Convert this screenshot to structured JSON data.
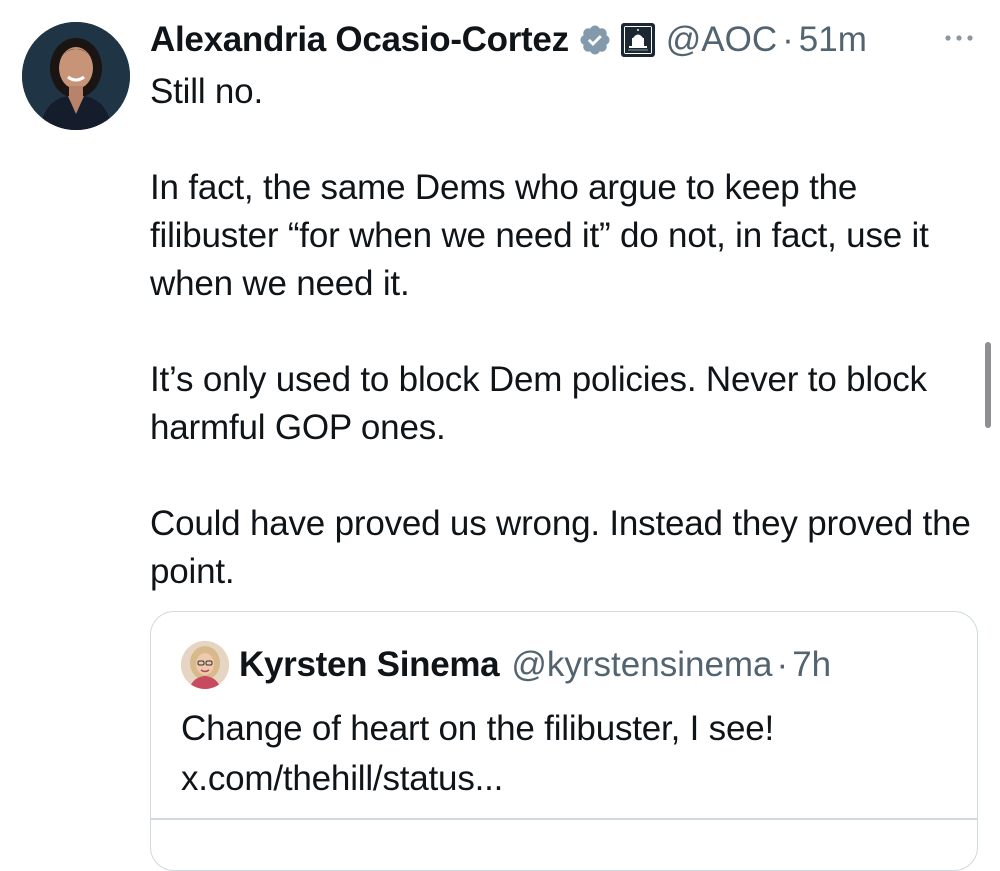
{
  "tweet": {
    "author_name": "Alexandria Ocasio-Cortez",
    "handle": "@AOC",
    "separator": "·",
    "time": "51m",
    "paragraphs": [
      "Still no.",
      "In fact, the same Dems who argue to keep the filibuster “for when we need it” do not, in fact, use it when we need it.",
      "It’s only used to block Dem policies. Never to block harmful GOP ones.",
      "Could have proved us wrong. Instead they proved the point."
    ]
  },
  "quoted_tweet": {
    "author_name": "Kyrsten Sinema",
    "handle": "@kyrstensinema",
    "separator": "·",
    "time": "7h",
    "text_lines": [
      "Change of heart on the filibuster, I see!",
      "x.com/thehill/status..."
    ]
  },
  "icons": {
    "avatar": "profile-photo",
    "verified": "verified-check-badge-icon",
    "affiliation": "capitol-building-affiliation-icon",
    "more": "more-options-icon"
  },
  "colors": {
    "text_primary": "#0f1419",
    "text_secondary": "#536471",
    "border": "#cfd9de",
    "verified_badge": "#829aab"
  }
}
